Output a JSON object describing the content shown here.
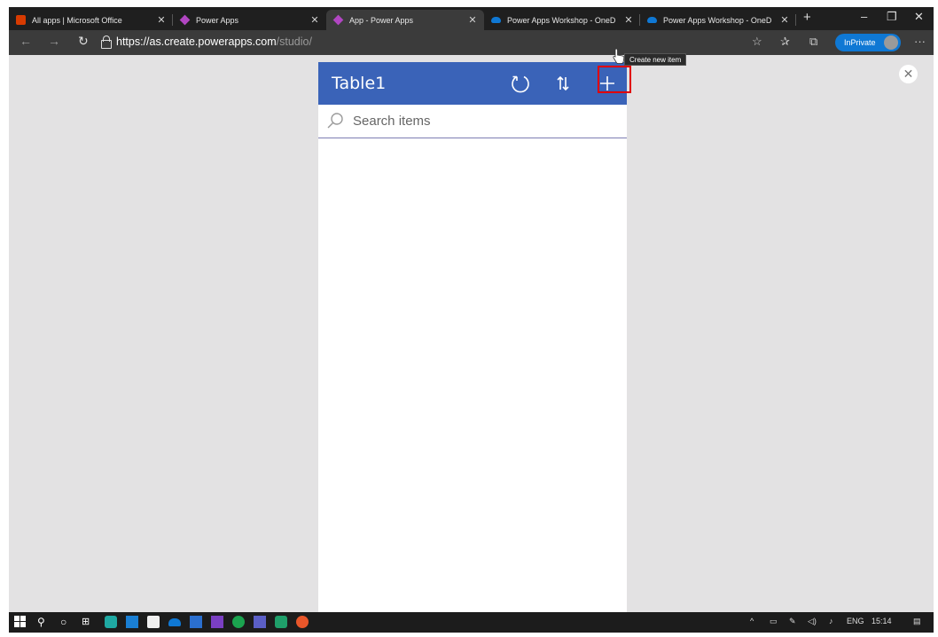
{
  "browser": {
    "tabs": [
      {
        "title": "All apps | Microsoft Office",
        "icon": "office-icon"
      },
      {
        "title": "Power Apps",
        "icon": "powerapps-icon"
      },
      {
        "title": "App - Power Apps",
        "icon": "powerapps-icon"
      },
      {
        "title": "Power Apps Workshop - OneD",
        "icon": "onedrive-icon"
      },
      {
        "title": "Power Apps Workshop - OneD",
        "icon": "onedrive-icon"
      }
    ],
    "url_main": "https://as.create.powerapps.com",
    "url_path": "/studio/",
    "inprivate_label": "InPrivate",
    "colors": {
      "tabstrip": "#1f1f1f",
      "toolbar": "#3b3b3b",
      "accent": "#0f78d4"
    }
  },
  "app": {
    "title": "Table1",
    "header_color": "#3a63b8",
    "search_placeholder": "Search items",
    "tooltip": "Create new item",
    "icons": {
      "refresh": "refresh-icon",
      "sort": "sort-icon",
      "add": "add-icon",
      "search": "search-icon"
    }
  },
  "taskbar": {
    "language": "ENG",
    "time": "15:14"
  }
}
